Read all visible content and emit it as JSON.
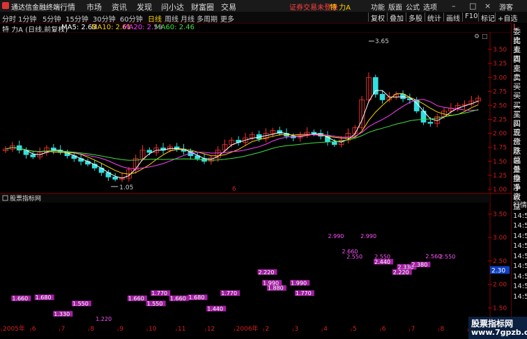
{
  "app": {
    "title": "通达信金融终端",
    "menu": [
      "行情",
      "市场",
      "资讯",
      "发现",
      "问小达",
      "财富圈",
      "交易"
    ],
    "warning": "证券交易未登录",
    "stock": "特 力A",
    "right_menu": [
      "功能",
      "版面",
      "公式",
      "选项"
    ],
    "user": "游客",
    "win_buttons": [
      "–",
      "□",
      "×"
    ]
  },
  "toolbar": {
    "periods": [
      "分时",
      "1分钟",
      "5分钟",
      "15分钟",
      "30分钟",
      "60分钟",
      "日线",
      "周线",
      "月线",
      "多周期",
      "更多"
    ],
    "active": "日线",
    "right": [
      "复权",
      "叠加",
      "多股",
      "统计",
      "画线",
      "F10",
      "标记",
      "+自选"
    ]
  },
  "legend": {
    "name": "特 力A (日线,前复权)",
    "items": [
      {
        "label": "MA5: 2.63",
        "color": "#ffffff"
      },
      {
        "label": "MA10: 2.61",
        "color": "#ffd400"
      },
      {
        "label": "MA20: 2.59",
        "color": "#ff40ff"
      },
      {
        "label": "MA60: 2.46",
        "color": "#40e040"
      }
    ]
  },
  "sub_panel": {
    "title": "股票指标网"
  },
  "annotations": {
    "high": "3.65",
    "low": "1.05",
    "marker": "6"
  },
  "right_panel": {
    "top_label": "L",
    "labels": [
      "委比",
      "卖五",
      "卖四",
      "卖三",
      "卖二",
      "卖一",
      "买一",
      "买二",
      "买三",
      "买四",
      "买五",
      "现价",
      "涨跌",
      "涨幅",
      "总量",
      "外盘",
      "换手",
      "净资",
      "收益"
    ],
    "bottom_labels": [
      "行情",
      "14:50",
      "14:50",
      "14:50",
      "14:50",
      "14:50",
      "14:50",
      "14:50",
      "14:50",
      "14:50"
    ]
  },
  "chart_data": [
    {
      "type": "candlestick",
      "title": "特 力A (日线,前复权)",
      "ylim": [
        0.95,
        3.75
      ],
      "yticks": [
        "3.50",
        "3.25",
        "3.00",
        "2.75",
        "2.50",
        "2.25",
        "2.00",
        "1.75",
        "1.50",
        "1.25",
        "1.00"
      ],
      "x_labels": [
        "2005年",
        "6",
        "7",
        "8",
        "9",
        "10",
        "11",
        "12",
        "2006年",
        "2",
        "3",
        "4",
        "5",
        "6",
        "7",
        "8",
        "9"
      ],
      "annotations": [
        {
          "text": "3.65",
          "kind": "high"
        },
        {
          "text": "1.05",
          "kind": "low"
        }
      ],
      "series": [
        {
          "name": "MA5",
          "value": 2.63,
          "color": "#ffffff"
        },
        {
          "name": "MA10",
          "value": 2.61,
          "color": "#ffd400"
        },
        {
          "name": "MA20",
          "value": 2.59,
          "color": "#ff40ff"
        },
        {
          "name": "MA60",
          "value": 2.46,
          "color": "#40e040"
        }
      ],
      "close_path": [
        1.72,
        1.78,
        1.7,
        1.62,
        1.58,
        1.66,
        1.74,
        1.7,
        1.66,
        1.6,
        1.55,
        1.5,
        1.45,
        1.38,
        1.3,
        1.22,
        1.18,
        1.2,
        1.35,
        1.55,
        1.7,
        1.66,
        1.74,
        1.7,
        1.76,
        1.72,
        1.68,
        1.6,
        1.55,
        1.5,
        1.56,
        1.7,
        1.8,
        1.88,
        1.84,
        1.92,
        1.98,
        1.9,
        2.0,
        2.05,
        2.0,
        1.95,
        1.92,
        1.96,
        2.02,
        2.0,
        1.95,
        1.85,
        1.8,
        1.88,
        2.0,
        2.1,
        2.6,
        3.0,
        2.7,
        2.6,
        2.65,
        2.7,
        2.62,
        2.6,
        2.4,
        2.2,
        2.18,
        2.3,
        2.4,
        2.45,
        2.5,
        2.52,
        2.58,
        2.63
      ]
    },
    {
      "type": "scatter",
      "title": "股票指标网",
      "ylim": [
        1.0,
        3.7
      ],
      "yticks": [
        "3.50",
        "3.00",
        "2.50",
        "2.00",
        "1.50"
      ],
      "current": "2.30",
      "labels": [
        {
          "text": "1.660",
          "x": 2,
          "y": 1.66
        },
        {
          "text": "1.680",
          "x": 7,
          "y": 1.68
        },
        {
          "text": "1.330",
          "x": 11,
          "y": 1.33
        },
        {
          "text": "1.550",
          "x": 15,
          "y": 1.55
        },
        {
          "text": "1.220",
          "x": 20,
          "y": 1.22
        },
        {
          "text": "1.660",
          "x": 27,
          "y": 1.66
        },
        {
          "text": "1.770",
          "x": 32,
          "y": 1.77
        },
        {
          "text": "1.550",
          "x": 31,
          "y": 1.55
        },
        {
          "text": "1.660",
          "x": 36,
          "y": 1.66
        },
        {
          "text": "1.680",
          "x": 40,
          "y": 1.68
        },
        {
          "text": "1.440",
          "x": 44,
          "y": 1.44
        },
        {
          "text": "1.770",
          "x": 47,
          "y": 1.77
        },
        {
          "text": "2.220",
          "x": 55,
          "y": 2.22
        },
        {
          "text": "1.990",
          "x": 56,
          "y": 1.99
        },
        {
          "text": "1.880",
          "x": 57,
          "y": 1.88
        },
        {
          "text": "1.990",
          "x": 62,
          "y": 1.99
        },
        {
          "text": "1.770",
          "x": 63,
          "y": 1.77
        },
        {
          "text": "2.990",
          "x": 70,
          "y": 2.99
        },
        {
          "text": "2.660",
          "x": 73,
          "y": 2.66
        },
        {
          "text": "2.550",
          "x": 74,
          "y": 2.55
        },
        {
          "text": "2.990",
          "x": 77,
          "y": 2.99
        },
        {
          "text": "2.550",
          "x": 80,
          "y": 2.55
        },
        {
          "text": "2.440",
          "x": 80,
          "y": 2.44
        },
        {
          "text": "2.330",
          "x": 85,
          "y": 2.33
        },
        {
          "text": "2.220",
          "x": 84,
          "y": 2.22
        },
        {
          "text": "2.380",
          "x": 88,
          "y": 2.38
        },
        {
          "text": "2.560",
          "x": 91,
          "y": 2.56
        },
        {
          "text": "2.550",
          "x": 94,
          "y": 2.55
        }
      ]
    }
  ],
  "watermark": {
    "line1": "股票指标网",
    "line2": "www.7gpzb.com"
  }
}
